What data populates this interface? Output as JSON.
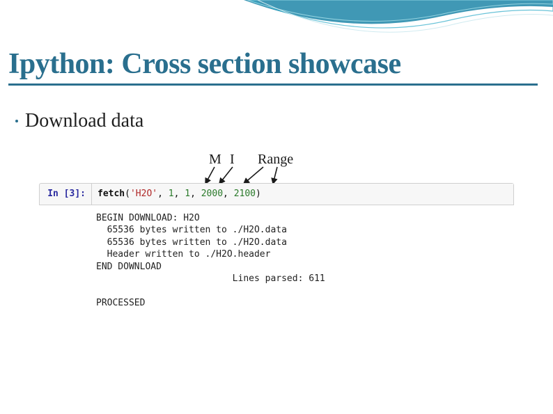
{
  "title": "Ipython: Cross section showcase",
  "bullet": "Download data",
  "annotations": {
    "m": "M",
    "i": "I",
    "range": "Range"
  },
  "cell": {
    "prompt": "In [3]:",
    "code": {
      "func": "fetch",
      "open": "(",
      "str": "'H2O'",
      "c1": ",",
      "n1": "1",
      "c2": ",",
      "n2": "1",
      "c3": ",",
      "n3": "2000",
      "c4": ",",
      "n4": "2100",
      "close": ")"
    },
    "output_lines": [
      "BEGIN DOWNLOAD: H2O",
      "  65536 bytes written to ./H2O.data",
      "  65536 bytes written to ./H2O.data",
      "  Header written to ./H2O.header",
      "END DOWNLOAD",
      "                         Lines parsed: 611",
      "",
      "PROCESSED"
    ]
  }
}
